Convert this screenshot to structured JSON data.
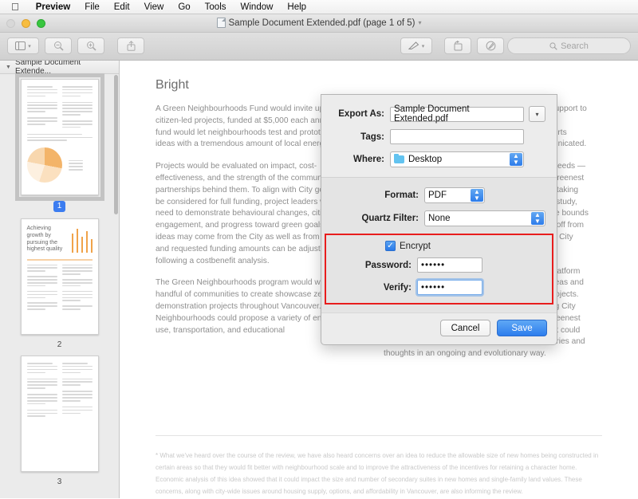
{
  "menubar": {
    "apple_icon": "apple-icon",
    "items": [
      {
        "label": "Preview",
        "bold": true
      },
      {
        "label": "File",
        "bold": false
      },
      {
        "label": "Edit",
        "bold": false
      },
      {
        "label": "View",
        "bold": false
      },
      {
        "label": "Go",
        "bold": false
      },
      {
        "label": "Tools",
        "bold": false
      },
      {
        "label": "Window",
        "bold": false
      },
      {
        "label": "Help",
        "bold": false
      }
    ]
  },
  "window": {
    "title": "Sample Document Extended.pdf (page 1 of 5)",
    "traffic_lights": [
      "close",
      "minimize",
      "maximize"
    ]
  },
  "toolbar": {
    "sidebar_icon": "sidebar-icon",
    "sidebar_chevron": "chevron-down-icon",
    "zoom_out_icon": "zoom-out-icon",
    "zoom_in_icon": "zoom-in-icon",
    "share_icon": "share-icon",
    "markup_icon": "markup-pen-icon",
    "markup_chevron": "chevron-down-icon",
    "rotate_icon": "rotate-icon",
    "annotate_icon": "annotate-icon",
    "search_icon": "search-icon",
    "search_placeholder": "Search"
  },
  "sidebar": {
    "header_label": "Sample Document Extende...",
    "disclosure_icon": "triangle-down-icon",
    "thumbnails": [
      {
        "page_label": "1",
        "selected": true,
        "heading": "",
        "kind": "pie"
      },
      {
        "page_label": "2",
        "selected": false,
        "heading": "Achieving growth by pursuing the highest quality",
        "kind": "bars"
      },
      {
        "page_label": "3",
        "selected": false,
        "heading": "",
        "kind": "text"
      }
    ]
  },
  "document": {
    "heading": "Bright",
    "left_column": [
      "A Green Neighbourhoods Fund would invite up to 100 citizen-led projects, funded at $5,000 each annually. The fund would let neighbourhoods test and prototype green ideas with a tremendous amount of local energy.",
      "Projects would be evaluated on impact, cost-effectiveness, and the strength of the community partnerships behind them. To align with City goals and to be considered for full funding, project leaders would need to demonstrate behavioural changes, citizen engagement, and progress toward green goals. Project ideas may come from the City as well as from citizens, and requested funding amounts can be adjusted following a costbenefit analysis.",
      "The Green Neighbourhoods program would work with a handful of communities to create showcase zero-carbon demonstration projects throughout Vancouver. Neighbourhoods could propose a variety of energy, land-use, transportation, and educational"
    ],
    "right_column": [
      "The City would provide financial and technical support to build upon these ideas, perhaps with input from businesses, academics, and other advisors. Efforts would be closely monitored and success communicated.",
      "The Green Seeds Fund is like the scattering of seeds — many might take root within the City, while the Greenest City Showcase Neighbourhoods program is like taking multiple seeds with serious fertilizer and careful study, cross-pollination/synergy effects, and to push the bounds of what can be done. The former is more hands off from City staff, while the latter likely would need more City staff involvement.",
      "Connected to these initiatives would be a new platform for documenting, sharing, and improving best ideas and lessons learned from pilot and demonstration projects. For example, it could be a review panel including City staff and citizens to review Green Seeds and Greenest City Showcase Neighbourhoods outcomes. Or, it could be a wiki site where people upload their own stories and thoughts in an ongoing and evolutionary way."
    ],
    "footnote": "* What we've heard over the course of the review, we have also heard concerns over an idea to reduce the allowable size of new homes being constructed in certain areas so that they would fit better with neighbourhood scale and to improve the attractiveness of the incentives for retaining a character home. Economic analysis of this idea showed that it could impact the size and number of secondary suites in new homes and single-family land values. These concerns, along with city-wide issues around housing supply, options, and affordability in Vancouver, are also informing the review."
  },
  "export_dialog": {
    "export_as_label": "Export As:",
    "export_as_value": "Sample Document Extended.pdf",
    "expand_icon": "chevron-down-icon",
    "tags_label": "Tags:",
    "tags_value": "",
    "where_label": "Where:",
    "where_value": "Desktop",
    "where_icon": "folder-icon",
    "format_label": "Format:",
    "format_value": "PDF",
    "quartz_label": "Quartz Filter:",
    "quartz_value": "None",
    "encrypt_label": "Encrypt",
    "encrypt_checked": true,
    "check_glyph": "✓",
    "password_label": "Password:",
    "password_value": "••••••",
    "verify_label": "Verify:",
    "verify_value": "••••••",
    "cancel_label": "Cancel",
    "save_label": "Save",
    "highlight_color": "#e81d1d",
    "accent_color": "#2d7ded"
  }
}
